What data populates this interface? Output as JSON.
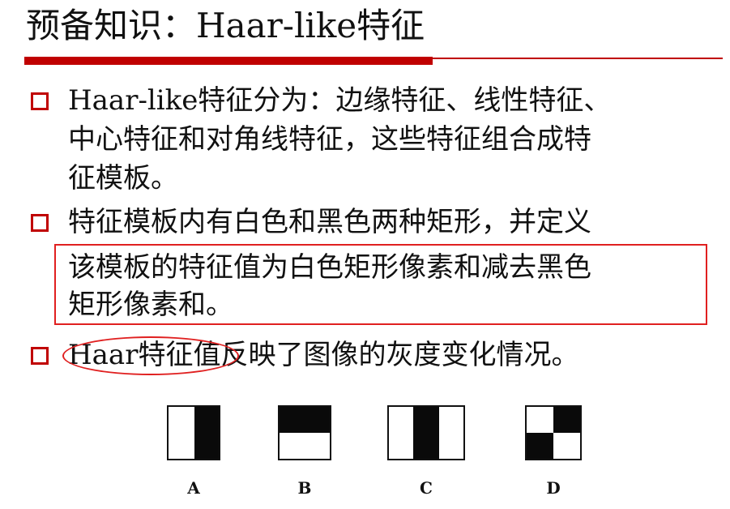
{
  "slide": {
    "title": "预备知识：Haar-like特征",
    "accent_color": "#c00000",
    "highlight_color": "#e02020"
  },
  "bullets": [
    {
      "icon": "square-bullet-icon",
      "lines": [
        "Haar-like特征分为：边缘特征、线性特征、",
        "中心特征和对角线特征，这些特征组合成特",
        "征模板。"
      ]
    },
    {
      "icon": "square-bullet-icon",
      "lines": [
        "特征模板内有白色和黑色两种矩形，并定义",
        "该模板的特征值为白色矩形像素和减去黑色",
        "矩形像素和。"
      ]
    },
    {
      "icon": "square-bullet-icon",
      "lines": [
        "Haar特征值反映了图像的灰度变化情况。"
      ]
    }
  ],
  "features": [
    {
      "label": "A",
      "type": "edge-vertical"
    },
    {
      "label": "B",
      "type": "edge-horizontal"
    },
    {
      "label": "C",
      "type": "line-vertical"
    },
    {
      "label": "D",
      "type": "diagonal"
    }
  ]
}
